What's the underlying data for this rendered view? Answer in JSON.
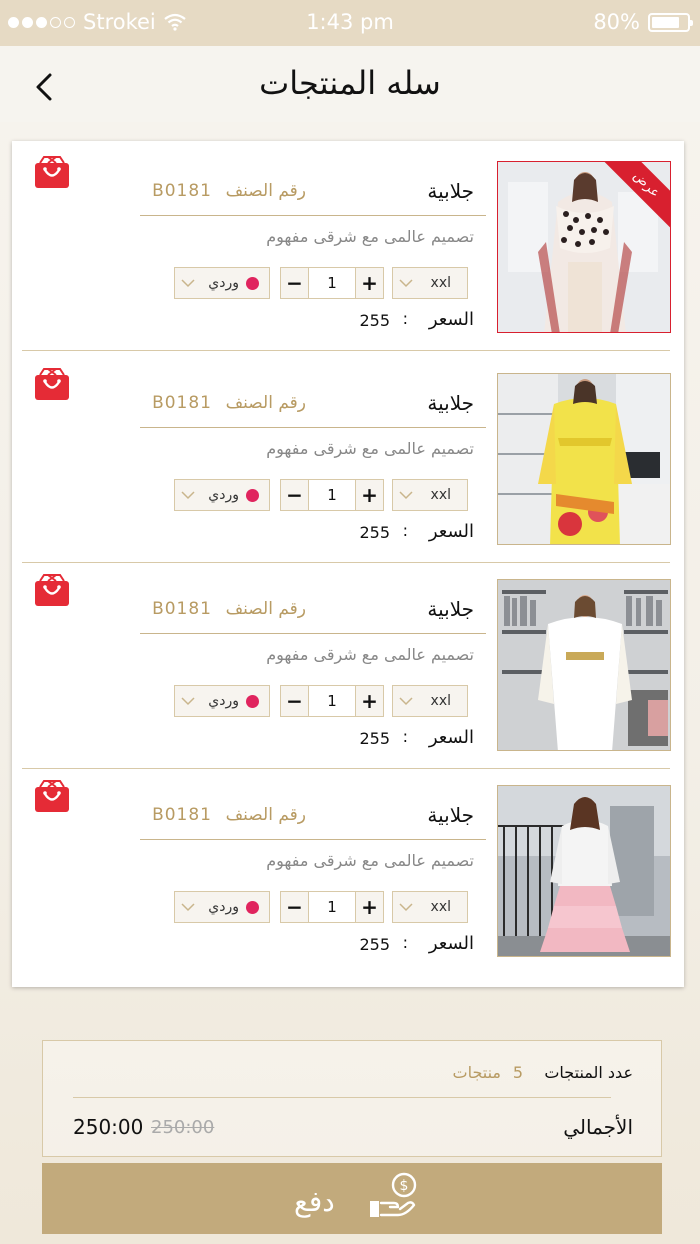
{
  "status_bar": {
    "carrier": "Strokei",
    "time": "1:43 pm",
    "battery": "80%",
    "battery_level": 0.8
  },
  "header": {
    "title": "سله المنتجات"
  },
  "items": [
    {
      "name": "جلابية",
      "code_label": "رقم الصنف",
      "code": "B0181",
      "description": "تصميم عالمى مع شرقى مفهوم",
      "size": "xxl",
      "quantity": "1",
      "color_name": "وردي",
      "color": "#e0245e",
      "price_label": "السعر",
      "price": "255",
      "promo": "عرض"
    },
    {
      "name": "جلابية",
      "code_label": "رقم الصنف",
      "code": "B0181",
      "description": "تصميم عالمى مع شرقى مفهوم",
      "size": "xxl",
      "quantity": "1",
      "color_name": "وردي",
      "color": "#e0245e",
      "price_label": "السعر",
      "price": "255"
    },
    {
      "name": "جلابية",
      "code_label": "رقم الصنف",
      "code": "B0181",
      "description": "تصميم عالمى مع شرقى مفهوم",
      "size": "xxl",
      "quantity": "1",
      "color_name": "وردي",
      "color": "#e0245e",
      "price_label": "السعر",
      "price": "255"
    },
    {
      "name": "جلابية",
      "code_label": "رقم الصنف",
      "code": "B0181",
      "description": "تصميم عالمى مع شرقى مفهوم",
      "size": "xxl",
      "quantity": "1",
      "color_name": "وردي",
      "color": "#e0245e",
      "price_label": "السعر",
      "price": "255"
    }
  ],
  "summary": {
    "count_label": "عدد المنتجات",
    "count": "5",
    "count_unit": "منتجات",
    "total_label": "الأجمالي",
    "total_old": "250:00",
    "total_new": "250:00"
  },
  "pay_button": {
    "label": "دفع"
  },
  "colors": {
    "accent": "#c2aa7c",
    "gold_text": "#b89b63",
    "promo_red": "#d8202f",
    "delete_red": "#e52b36"
  }
}
